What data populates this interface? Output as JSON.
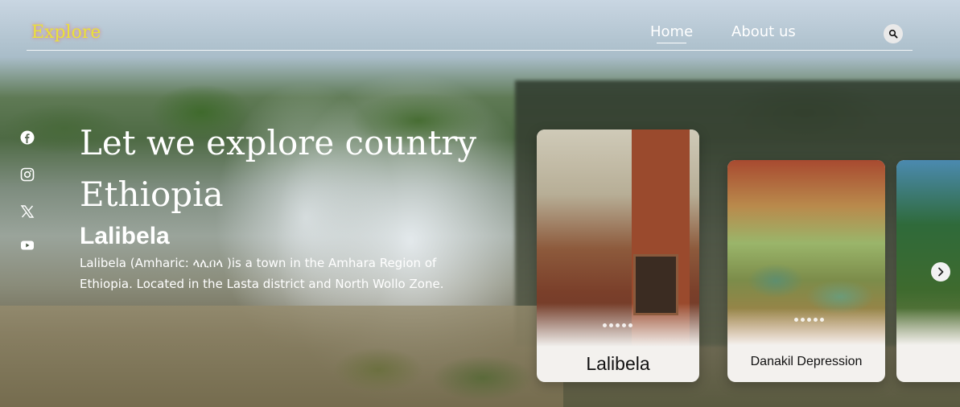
{
  "nav": {
    "logo": "Explore",
    "links": [
      "Home",
      "About us"
    ],
    "search_icon": "search-icon"
  },
  "social": [
    "facebook-icon",
    "instagram-icon",
    "x-icon",
    "youtube-icon"
  ],
  "hero": {
    "title": "Let we explore country Ethiopia",
    "place_name": "Lalibela",
    "place_description": "Lalibela (Amharic: ላሊበላ )is a town in the Amhara Region of Ethiopia. Located in the Lasta district and North Wollo Zone."
  },
  "cards": [
    {
      "label": "Lalibela"
    },
    {
      "label": "Danakil Depression"
    },
    {
      "label": ""
    }
  ],
  "carousel": {
    "next_icon": "chevron-right-icon"
  }
}
